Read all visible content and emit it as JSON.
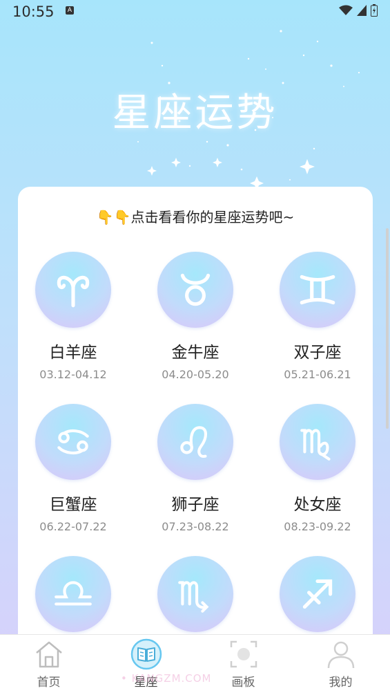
{
  "status_bar": {
    "time": "10:55",
    "notif_label": "A"
  },
  "header": {
    "title": "星座运势"
  },
  "card": {
    "tip": "👇👇点击看看你的星座运势吧~",
    "zodiacs": [
      {
        "name": "白羊座",
        "date": "03.12-04.12",
        "icon": "aries-icon"
      },
      {
        "name": "金牛座",
        "date": "04.20-05.20",
        "icon": "taurus-icon"
      },
      {
        "name": "双子座",
        "date": "05.21-06.21",
        "icon": "gemini-icon"
      },
      {
        "name": "巨蟹座",
        "date": "06.22-07.22",
        "icon": "cancer-icon"
      },
      {
        "name": "狮子座",
        "date": "07.23-08.22",
        "icon": "leo-icon"
      },
      {
        "name": "处女座",
        "date": "08.23-09.22",
        "icon": "virgo-icon"
      },
      {
        "name": "",
        "date": "",
        "icon": "libra-icon"
      },
      {
        "name": "",
        "date": "",
        "icon": "scorpio-icon"
      },
      {
        "name": "",
        "date": "",
        "icon": "sagittarius-icon"
      }
    ]
  },
  "tabbar": {
    "tabs": [
      {
        "label": "首页",
        "icon": "home-icon"
      },
      {
        "label": "星座",
        "icon": "book-icon"
      },
      {
        "label": "画板",
        "icon": "camera-scan-icon"
      },
      {
        "label": "我的",
        "icon": "user-icon"
      }
    ],
    "active_index": 1
  },
  "watermark": "• KANGZM.COM",
  "colors": {
    "accent": "#66c7f0",
    "circle_top": "#a5e8fb",
    "circle_bottom": "#dcc5f8"
  }
}
